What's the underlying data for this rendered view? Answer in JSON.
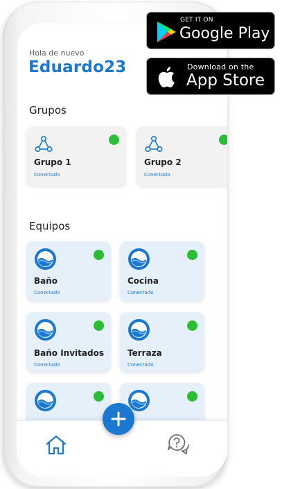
{
  "greeting": "Hola de nuevo",
  "username": "Eduardo23",
  "sections": {
    "groups_title": "Grupos",
    "devices_title": "Equipos"
  },
  "groups": [
    {
      "name": "Grupo 1",
      "status": "Conectado"
    },
    {
      "name": "Grupo 2",
      "status": "Conectado"
    }
  ],
  "devices": [
    {
      "name": "Baño",
      "status": "Conectado"
    },
    {
      "name": "Cocina",
      "status": "Conectado"
    },
    {
      "name": "Baño Invitados",
      "status": "Conectado"
    },
    {
      "name": "Terraza",
      "status": "Conectado"
    }
  ],
  "badges": {
    "google_small": "GET IT ON",
    "google_big": "Google Play",
    "apple_small": "Download on the",
    "apple_big": "App Store"
  },
  "colors": {
    "accent": "#1a78d0",
    "online": "#2bbd34",
    "device_card": "#e5f0fb",
    "group_card": "#f2f2f2"
  },
  "icons": {
    "group": "group-network-icon",
    "device": "water-drop-icon",
    "add": "plus-icon",
    "home": "home-icon",
    "help": "help-chat-icon",
    "google": "google-play-icon",
    "apple": "apple-icon"
  }
}
